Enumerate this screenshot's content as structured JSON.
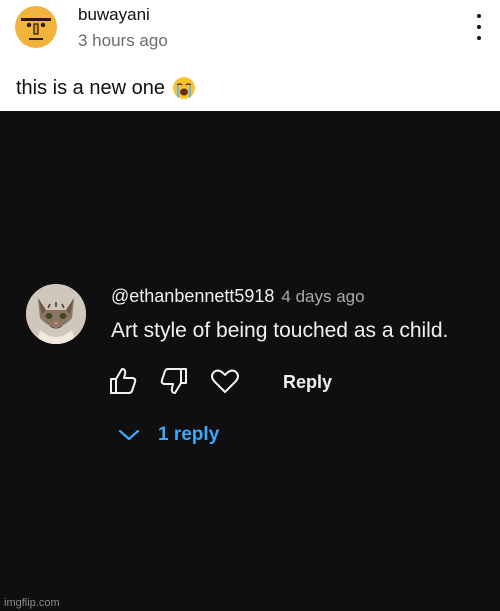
{
  "post": {
    "username": "buwayani",
    "time": "3 hours ago",
    "text": "this is a new one",
    "emoji_icon": "loudly-crying-face-icon",
    "more_icon": "more-vertical-icon"
  },
  "comment": {
    "avatar_icon": "cat-avatar",
    "handle": "@ethanbennett5918",
    "time": "4 days ago",
    "text": "Art style of being touched as a child.",
    "actions": {
      "like_icon": "thumbs-up-icon",
      "dislike_icon": "thumbs-down-icon",
      "heart_icon": "heart-icon",
      "reply_label": "Reply"
    },
    "replies_label": "1 reply",
    "replies_icon": "chevron-down-icon"
  },
  "watermark": "imgflip.com",
  "colors": {
    "dark_bg": "#0f0f0f",
    "link_blue": "#3ea6ff",
    "text_light": "#f1f1f1",
    "text_muted": "#aaaaaa"
  }
}
